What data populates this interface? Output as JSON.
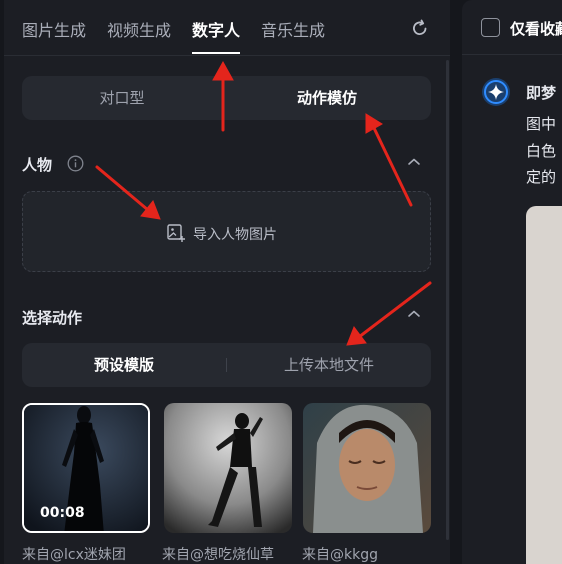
{
  "tabs": [
    {
      "label": "图片生成"
    },
    {
      "label": "视频生成"
    },
    {
      "label": "数字人"
    },
    {
      "label": "音乐生成"
    }
  ],
  "active_tab": "数字人",
  "mode": {
    "options": [
      "对口型",
      "动作模仿"
    ],
    "selected": "动作模仿"
  },
  "person": {
    "title": "人物",
    "upload_label": "导入人物图片"
  },
  "action": {
    "title": "选择动作",
    "options": [
      "预设模版",
      "上传本地文件"
    ],
    "selected": "预设模版",
    "templates": [
      {
        "duration": "00:08",
        "credit": "来自@lcx迷妹团"
      },
      {
        "credit": "来自@想吃烧仙草"
      },
      {
        "credit": "来自@kkgg"
      }
    ]
  },
  "right_panel": {
    "favorites_label": "仅看收藏",
    "assistant_name": "即梦",
    "lines": [
      "图中",
      "白色",
      "定的"
    ]
  },
  "colors": {
    "annotation": "#e4251c",
    "accent": "#2f8cff"
  }
}
